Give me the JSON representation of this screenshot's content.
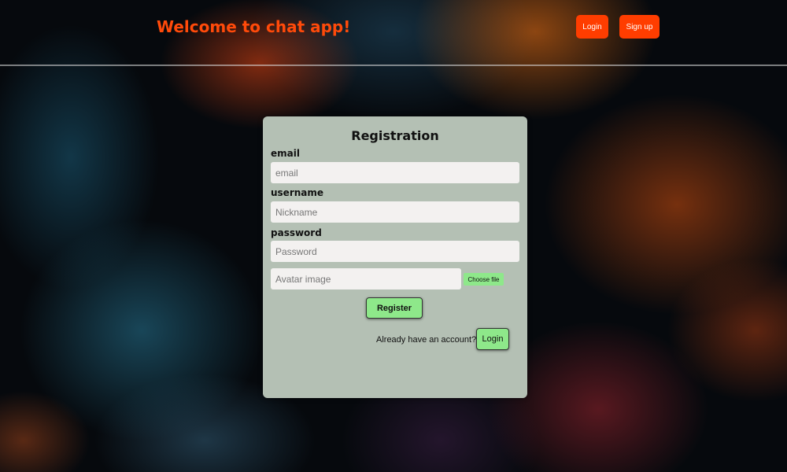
{
  "header": {
    "title": "Welcome to chat app!",
    "login_label": "Login",
    "signup_label": "Sign up"
  },
  "form": {
    "heading": "Registration",
    "email_label": "email",
    "email_placeholder": "email",
    "username_label": "username",
    "username_placeholder": "Nickname",
    "password_label": "password",
    "password_placeholder": "Password",
    "avatar_placeholder": "Avatar image",
    "file_button_label": "Choose file",
    "register_label": "Register",
    "account_question": "Already have an account?",
    "login_label": "Login"
  },
  "colors": {
    "accent": "#ff3d00",
    "title": "#ff4a0a",
    "card": "#b4c0b4",
    "green_button": "#8ee88a"
  }
}
